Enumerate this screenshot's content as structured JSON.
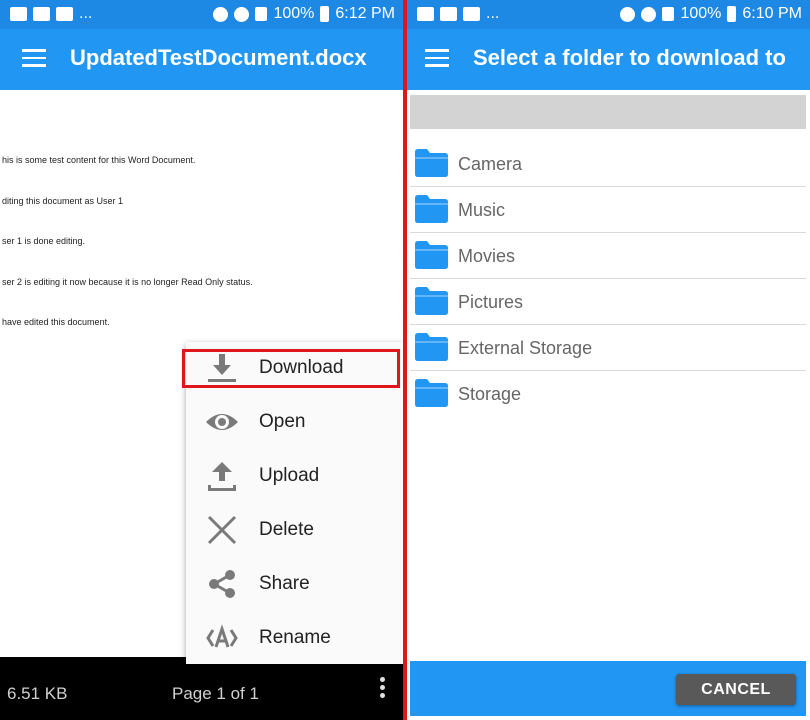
{
  "left": {
    "status": {
      "overflow": "...",
      "battery": "100%",
      "time": "6:12 PM"
    },
    "app_bar": {
      "title": "UpdatedTestDocument.docx"
    },
    "document_lines": [
      "his is some test content for this Word Document.",
      "diting this document as User 1",
      "ser 1 is done editing.",
      "ser 2 is editing it now because it is no longer Read Only status.",
      "have edited this document."
    ],
    "menu": [
      {
        "label": "Download",
        "icon": "download-icon"
      },
      {
        "label": "Open",
        "icon": "eye-icon"
      },
      {
        "label": "Upload",
        "icon": "upload-icon"
      },
      {
        "label": "Delete",
        "icon": "close-icon"
      },
      {
        "label": "Share",
        "icon": "share-icon"
      },
      {
        "label": "Rename",
        "icon": "rename-icon"
      }
    ],
    "bottom_bar": {
      "file_size": "6.51 KB",
      "page_indicator": "Page 1 of 1"
    }
  },
  "right": {
    "status": {
      "overflow": "...",
      "battery": "100%",
      "time": "6:10 PM"
    },
    "app_bar": {
      "title": "Select a folder to download to"
    },
    "folders": [
      "Camera",
      "Music",
      "Movies",
      "Pictures",
      "External Storage",
      "Storage"
    ],
    "cancel_label": "CANCEL"
  },
  "colors": {
    "status_bar": "#1e88e5",
    "app_bar": "#2196f3",
    "highlight": "#e0161d",
    "folder": "#2196f3",
    "cancel_button": "#595959"
  }
}
